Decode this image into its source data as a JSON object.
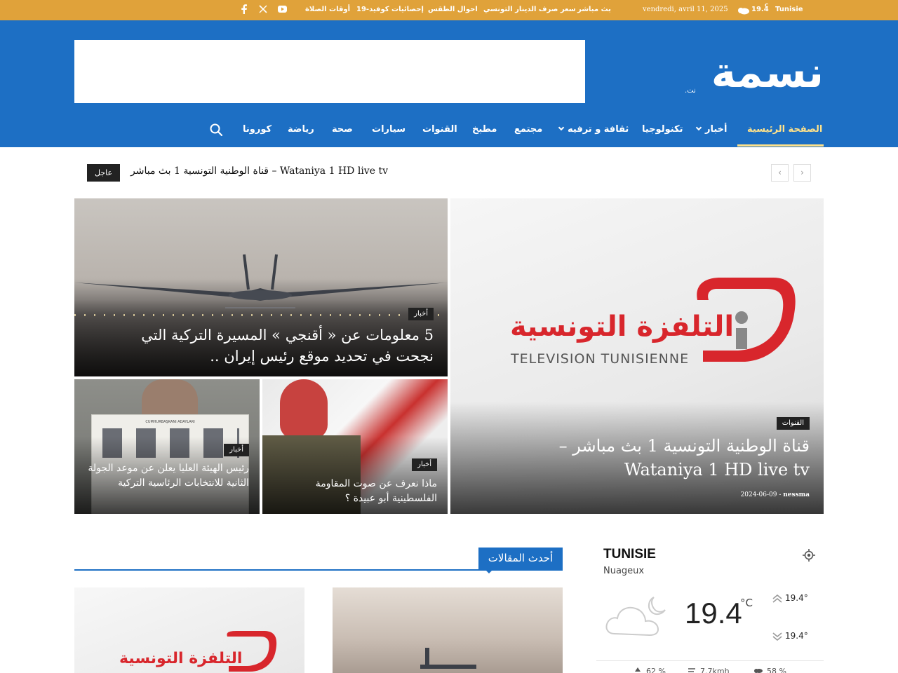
{
  "topbar": {
    "location": "Tunisie",
    "temp": "19.4",
    "unit": "C",
    "date": "vendredi, avril 11, 2025",
    "links": [
      "بث مباشر",
      "سعر صرف الدينار التونسي",
      "احوال الطقس",
      "إحصائيات كوفيد-19",
      "أوقات الصلاة"
    ],
    "social": [
      "youtube-icon",
      "x-icon",
      "facebook-icon"
    ]
  },
  "logo": {
    "text": "نسمة",
    "sub": ".نت"
  },
  "nav": {
    "items": [
      "الصفحة الرئيسية",
      "أخبار",
      "تكنولوجيا",
      "ثقافة و ترفيه",
      "مجتمع",
      "مطبخ",
      "القنوات",
      "سيارات",
      "صحة",
      "رياضة",
      "كورونا"
    ]
  },
  "ticker": {
    "badge": "عاجل",
    "text": "قناة الوطنية التونسية 1 بث مباشر – Wataniya 1 HD live tv"
  },
  "hero": {
    "main": {
      "category": "القنوات",
      "title": "قناة الوطنية التونسية 1 بث مباشر – Wataniya 1 HD live tv",
      "author": "nessma",
      "date": "2024-06-09",
      "logo_ar": "التلفزة التونسية",
      "logo_fr": "TELEVISION TUNISIENNE"
    },
    "top": {
      "category": "أخبار",
      "title": "5 معلومات عن « أقنجي » المسيرة التركية التي نجحت في تحديد موقع رئيس إيران .."
    },
    "left": {
      "category": "أخبار",
      "title": "رئيس الهيئة العليا يعلن عن موعد الجولة الثانية للانتخابات الرئاسية التركية",
      "ballot_heading": "CUMHURBAŞKANI ADAYLARI"
    },
    "right": {
      "category": "أخبار",
      "title": "ماذا نعرف عن صوت المقاومة الفلسطينية أبو عبيدة ؟"
    }
  },
  "section": {
    "title": "أحدث المقالات"
  },
  "weather": {
    "city": "TUNISIE",
    "desc": "Nuageux",
    "temp": "19.4",
    "unit": "°C",
    "high": "19.4°",
    "low": "19.4°",
    "humidity": "62 %",
    "wind": "7.7kmh",
    "clouds": "58 %"
  },
  "colors": {
    "header": "#1d6fc4",
    "topbar": "#e0a23a",
    "accent": "#ffe28a",
    "tv_red": "#d8262c"
  }
}
